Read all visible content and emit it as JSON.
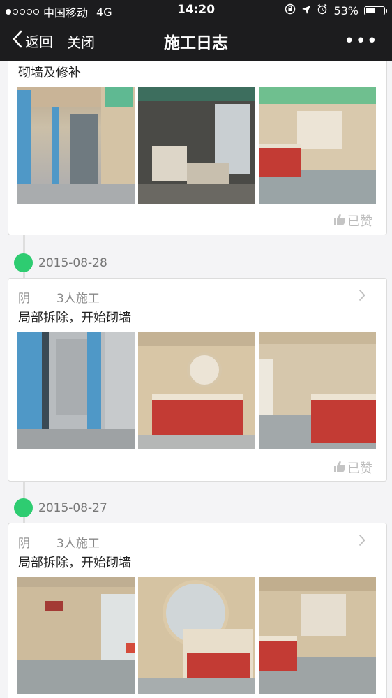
{
  "status_bar": {
    "carrier": "中国移动",
    "network": "4G",
    "time": "14:20",
    "battery_percent": "53%",
    "battery_level": 0.53,
    "signal_icon": "signal-dots-icon"
  },
  "nav": {
    "back_label": "返回",
    "close_label": "关闭",
    "title": "施工日志",
    "more_label": "•••"
  },
  "entries": [
    {
      "desc": "砌墙及修补",
      "like_label": "已赞"
    },
    {
      "date": "2015-08-28",
      "weather": "阴",
      "workers": "3人施工",
      "desc": "局部拆除，开始砌墙",
      "like_label": "已赞"
    },
    {
      "date": "2015-08-27",
      "weather": "阴",
      "workers": "3人施工",
      "desc": "局部拆除，开始砌墙"
    }
  ],
  "colors": {
    "bar_bg": "#1c1c1e",
    "timeline_green": "#2ecc71",
    "page_bg": "#f4f4f6"
  }
}
